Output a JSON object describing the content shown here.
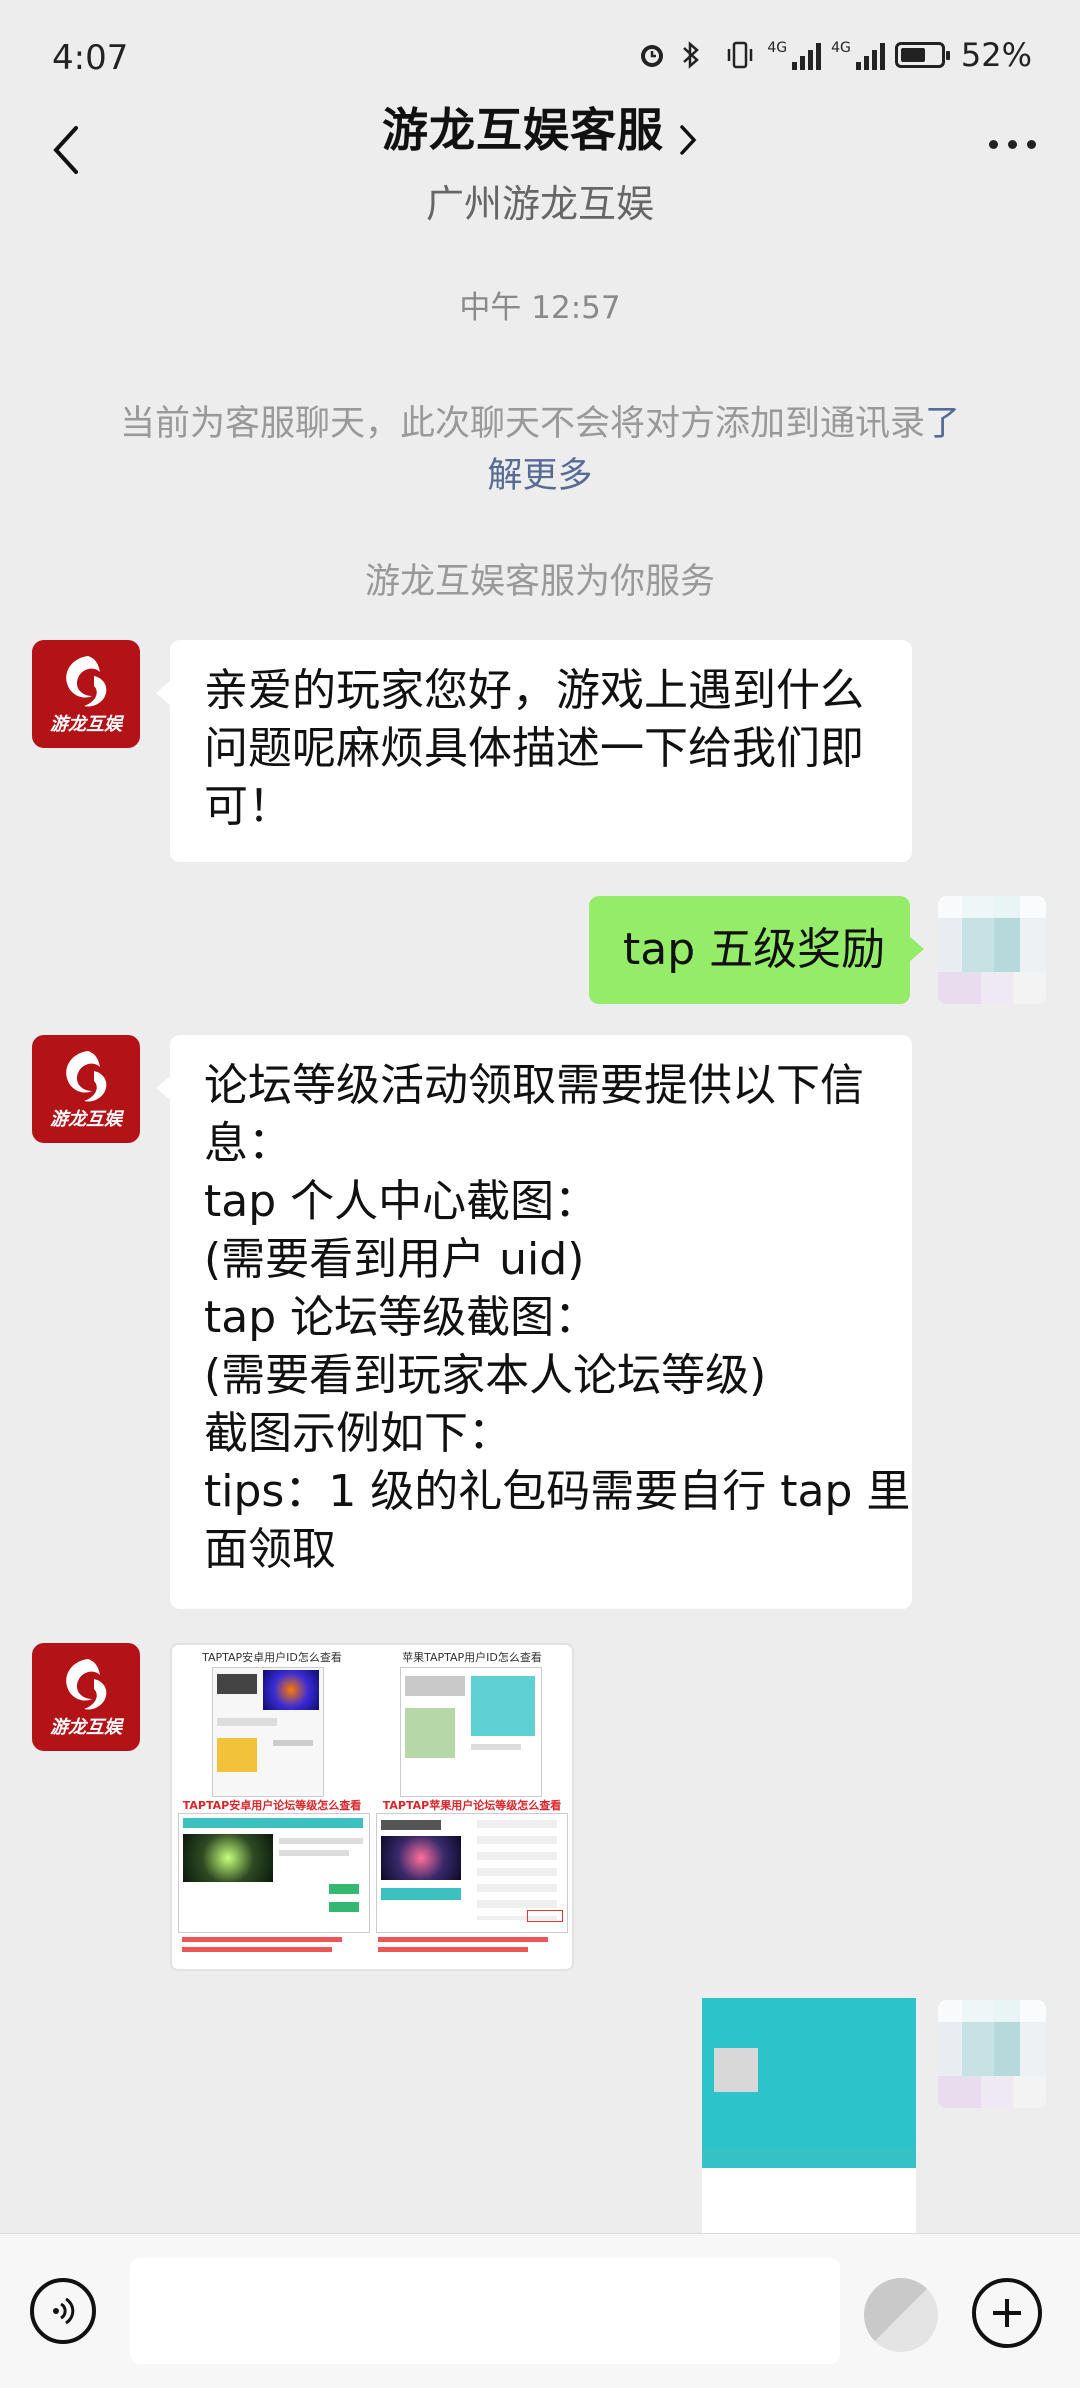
{
  "status_bar": {
    "time": "4:07",
    "battery_percent": "52%",
    "network_tag_1": "4G",
    "network_tag_2": "4G"
  },
  "header": {
    "title": "游龙互娱客服",
    "subtitle": "广州游龙互娱"
  },
  "chat": {
    "time_label": "中午 12:57",
    "notice_text": "当前为客服聊天，此次聊天不会将对方添加到通讯录",
    "notice_link_1": "了",
    "notice_link_2": "解更多",
    "service_line": "游龙互娱客服为你服务",
    "avatar_brand": "游龙互娱",
    "messages": [
      {
        "from": "service",
        "lines": [
          "亲爱的玩家您好，游戏上遇到什么",
          "问题呢麻烦具体描述一下给我们即",
          "可！"
        ]
      },
      {
        "from": "me",
        "text": "tap 五级奖励"
      },
      {
        "from": "service",
        "lines": [
          "论坛等级活动领取需要提供以下信",
          "息：",
          "tap 个人中心截图：",
          "(需要看到用户 uid)",
          "tap 论坛等级截图：",
          "(需要看到玩家本人论坛等级)",
          "截图示例如下：",
          "tips：1 级的礼包码需要自行 tap 里",
          "面领取"
        ]
      }
    ],
    "image_captions": {
      "top_left": "TAPTAP安卓用户ID怎么查看",
      "top_right": "苹果TAPTAP用户ID怎么查看",
      "mid_left": "TAPTAP安卓用户论坛等级怎么查看",
      "mid_right": "TAPTAP苹果用户论坛等级怎么查看"
    }
  },
  "input": {
    "placeholder": ""
  },
  "colors": {
    "background": "#ededed",
    "outgoing_bubble": "#95ec69",
    "incoming_bubble": "#ffffff",
    "link": "#576b95",
    "brand_red": "#b31217"
  }
}
